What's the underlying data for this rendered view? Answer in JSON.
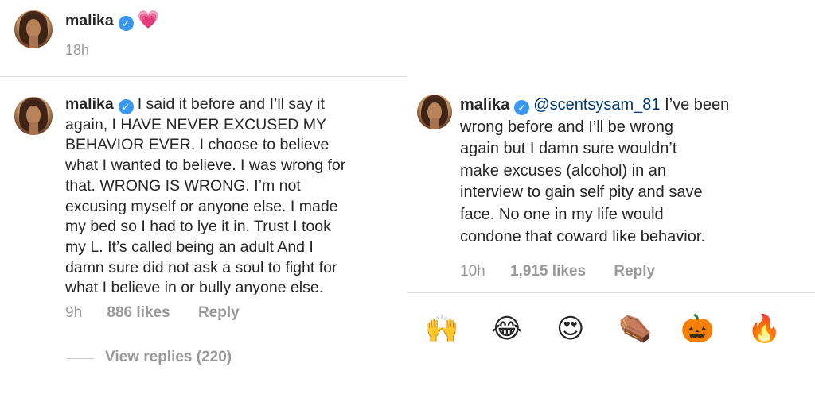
{
  "top_post": {
    "username": "malika",
    "extra_emoji": "💗",
    "time": "18h"
  },
  "left_comment": {
    "username": "malika",
    "lines": [
      "I said it before and I’ll say it",
      "again, I HAVE NEVER EXCUSED MY",
      "BEHAVIOR EVER. I choose to believe",
      "what I wanted to believe. I was wrong for",
      "that. WRONG IS WRONG. I’m not",
      "excusing myself or anyone else. I made",
      "my bed so I had to lye it in. Trust I took",
      "my L. It’s called being an adult And I",
      "damn sure did not ask a soul to fight for",
      "what I believe in or bully anyone else."
    ],
    "time": "9h",
    "likes": "886 likes",
    "reply": "Reply",
    "view_replies": "View replies (220)"
  },
  "right_comment": {
    "username": "malika",
    "mention": "@scentsysam_81",
    "lines": [
      "I’ve been",
      "wrong before and I’ll be wrong",
      "again but I damn sure wouldn’t",
      "make excuses (alcohol) in an",
      "interview to gain self pity and save",
      "face. No one in my life would",
      "condone that coward like behavior."
    ],
    "time": "10h",
    "likes": "1,915 likes",
    "reply": "Reply"
  },
  "emoji_bar": [
    {
      "glyph": "🙌",
      "name": "raising-hands-emoji"
    },
    {
      "glyph": "😂",
      "name": "tears-of-joy-emoji"
    },
    {
      "glyph": "😍",
      "name": "heart-eyes-emoji"
    },
    {
      "glyph": "⚰️",
      "name": "coffin-emoji"
    },
    {
      "glyph": "🎃",
      "name": "jack-o-lantern-emoji"
    },
    {
      "glyph": "🔥",
      "name": "fire-emoji"
    }
  ],
  "colors": {
    "text": "#262626",
    "muted": "#999999",
    "verified": "#3897f0",
    "mention": "#003569",
    "divider": "#dbdbdb"
  }
}
